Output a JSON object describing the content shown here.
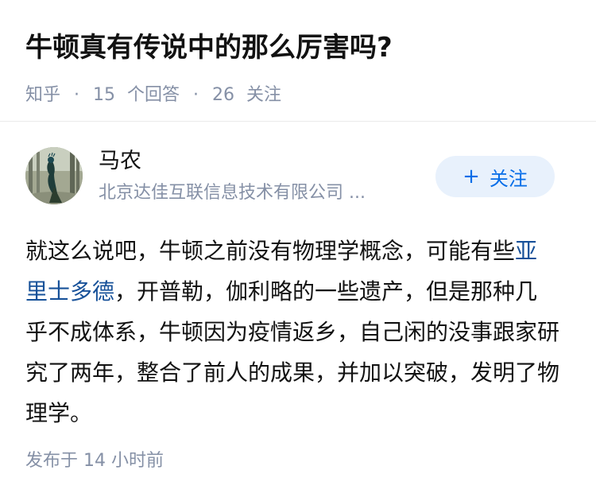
{
  "question": {
    "title": "牛顿真有传说中的那么厉害吗?",
    "source": "知乎",
    "answer_count": "15",
    "answer_label": "个回答",
    "follow_count": "26",
    "follow_label": "关注",
    "separator": "·"
  },
  "author": {
    "name": "马农",
    "headline": "北京达佳互联信息技术有限公司 ...",
    "follow_button_icon": "plus-icon",
    "follow_button_plus": "+",
    "follow_button_label": "关注"
  },
  "answer": {
    "text_before_link": "就这么说吧，牛顿之前没有物理学概念，可能有些",
    "link_text": "亚里士多德",
    "text_after_link": "，开普勒，伽利略的一些遗产，但是那种几乎不成体系，牛顿因为疫情返乡，自己闲的没事跟家研究了两年，整合了前人的成果，并加以突破，发明了物理学。",
    "publish_time": "发布于  14 小时前"
  },
  "colors": {
    "link": "#175199",
    "accent": "#056de8",
    "accent_bg": "#e8f1fc",
    "meta": "#8590a6"
  }
}
